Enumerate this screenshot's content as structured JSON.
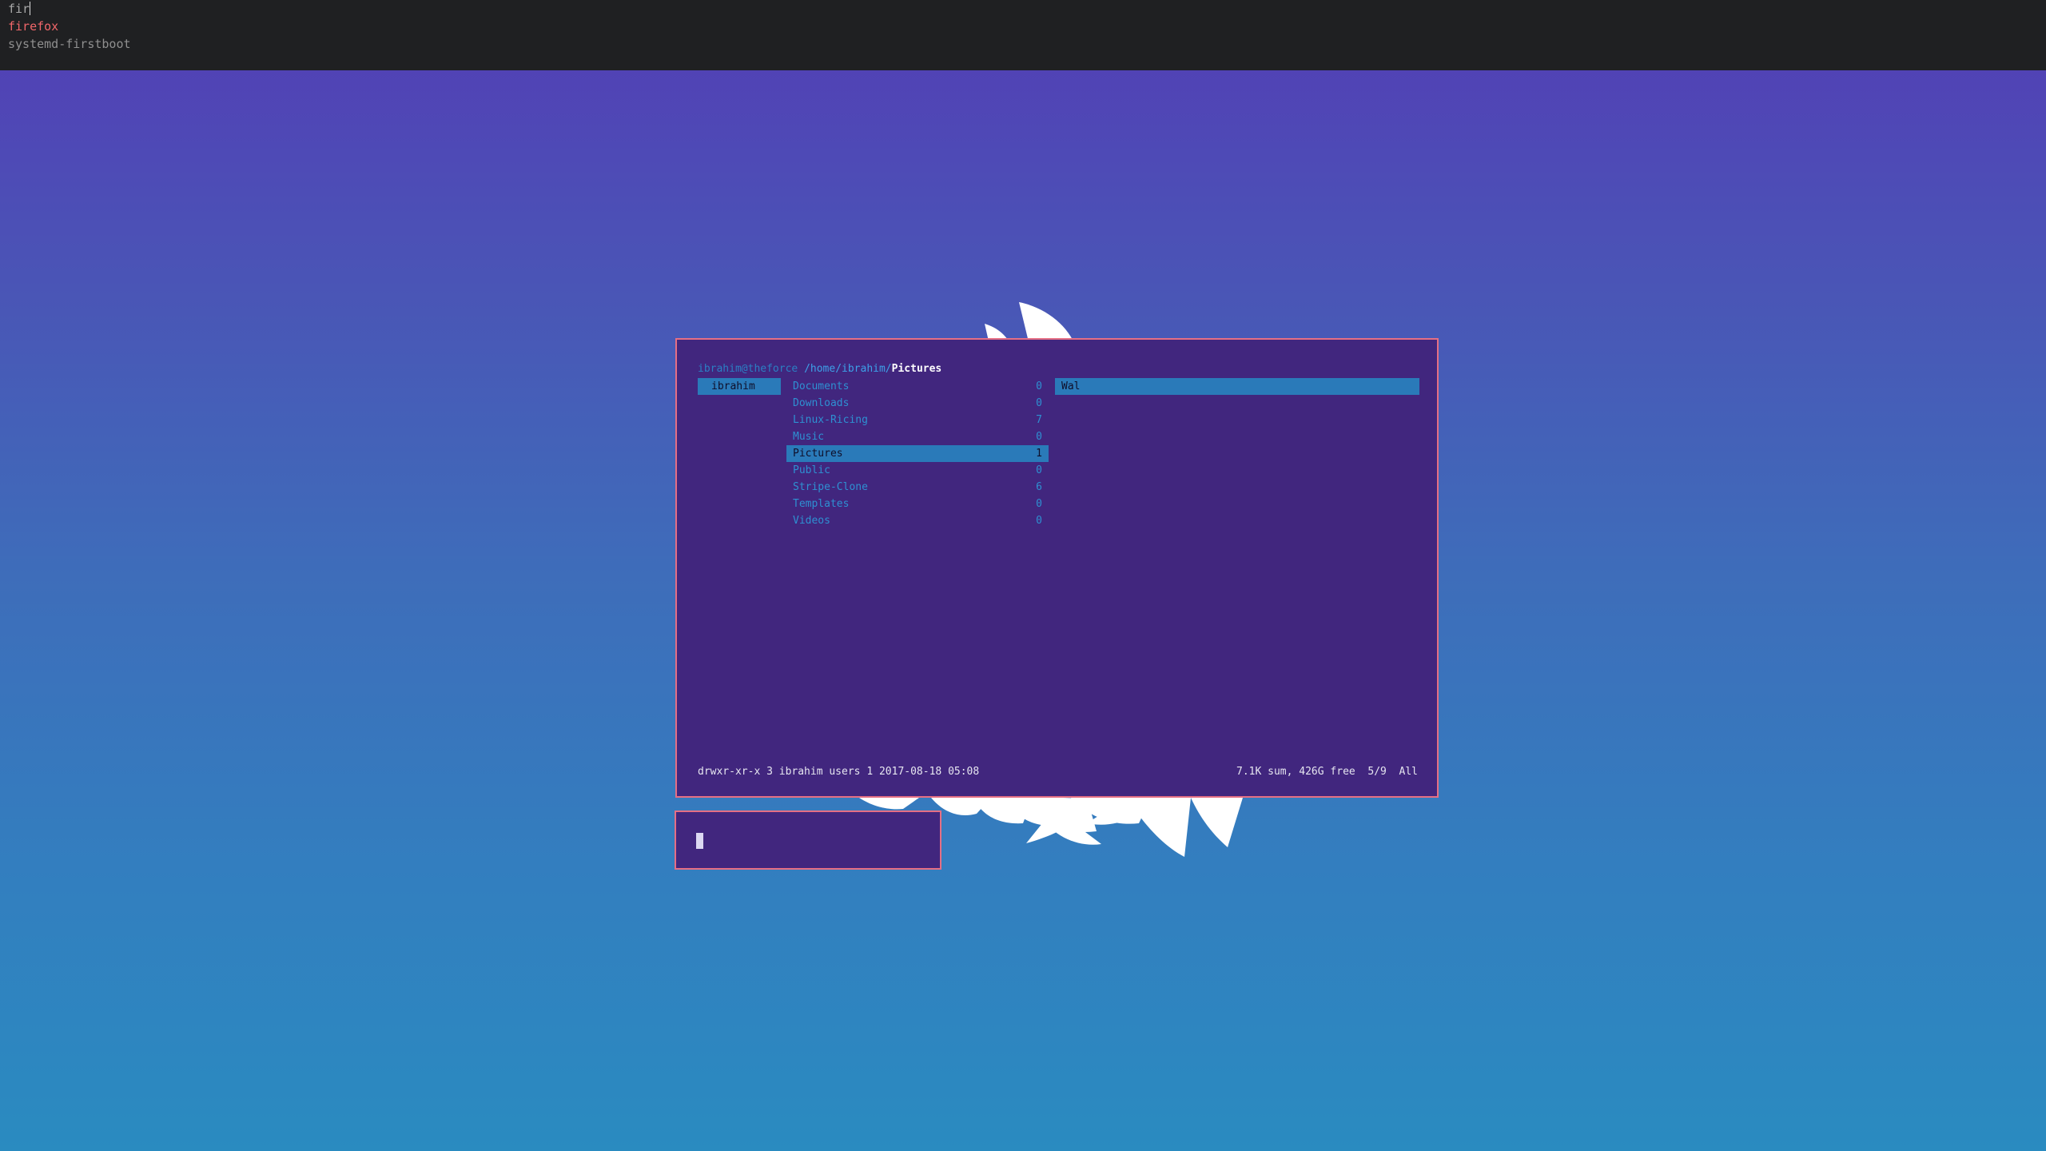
{
  "launcher": {
    "query": "fir",
    "items": [
      {
        "label": "firefox",
        "selected": true
      },
      {
        "label": "systemd-firstboot",
        "selected": false
      }
    ]
  },
  "ranger": {
    "host": "ibrahim@theforce",
    "path": "/home/ibrahim/",
    "current_dir": "Pictures",
    "parent_column": [
      {
        "label": "ibrahim",
        "selected": true
      }
    ],
    "main_column": [
      {
        "name": "Documents",
        "count": "0"
      },
      {
        "name": "Downloads",
        "count": "0"
      },
      {
        "name": "Linux-Ricing",
        "count": "7"
      },
      {
        "name": "Music",
        "count": "0"
      },
      {
        "name": "Pictures",
        "count": "1",
        "selected": true
      },
      {
        "name": "Public",
        "count": "0"
      },
      {
        "name": "Stripe-Clone",
        "count": "6"
      },
      {
        "name": "Templates",
        "count": "0"
      },
      {
        "name": "Videos",
        "count": "0"
      }
    ],
    "preview_column": [
      {
        "name": "Wal",
        "selected": true
      }
    ],
    "status_left": "drwxr-xr-x 3 ibrahim users 1 2017-08-18 05:08",
    "status_right": "7.1K sum, 426G free  5/9  All"
  },
  "colors": {
    "bg_top": "#533db5",
    "bg_bottom": "#2a8bc0",
    "terminal_bg": "#41267e",
    "terminal_border": "#e56f84",
    "highlight": "#2a7ab9",
    "launcher_bg": "#1f2022",
    "launcher_selected": "#f2676a"
  }
}
